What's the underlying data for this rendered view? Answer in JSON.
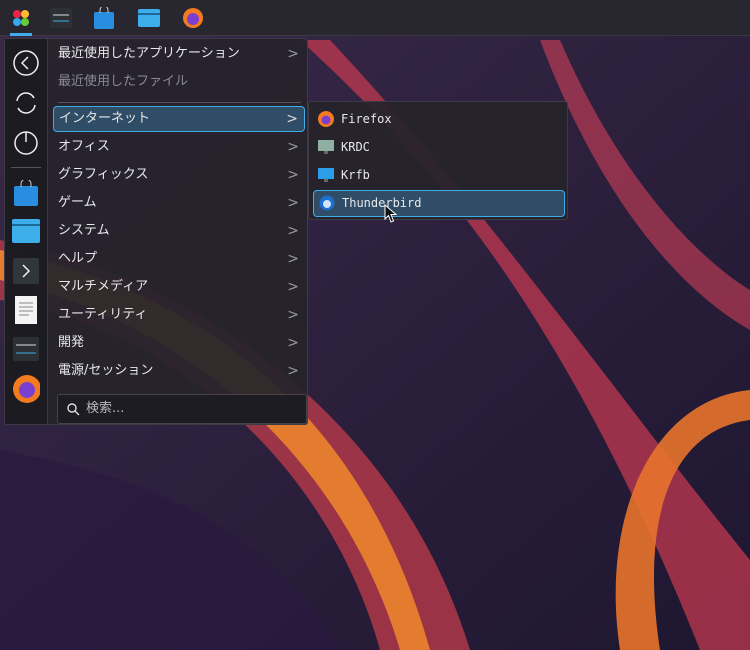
{
  "panel": {
    "icons": [
      "app-launcher-icon",
      "settings-icon",
      "discover-store-icon",
      "file-manager-icon",
      "firefox-icon"
    ]
  },
  "menu": {
    "items": [
      {
        "label": "最近使用したアプリケーション",
        "arrow": true
      },
      {
        "label": "最近使用したファイル",
        "arrow": false,
        "disabled": true
      },
      {
        "label": "インターネット",
        "arrow": true,
        "selected": true
      },
      {
        "label": "オフィス",
        "arrow": true
      },
      {
        "label": "グラフィックス",
        "arrow": true
      },
      {
        "label": "ゲーム",
        "arrow": true
      },
      {
        "label": "システム",
        "arrow": true
      },
      {
        "label": "ヘルプ",
        "arrow": true
      },
      {
        "label": "マルチメディア",
        "arrow": true
      },
      {
        "label": "ユーティリティ",
        "arrow": true
      },
      {
        "label": "開発",
        "arrow": true
      },
      {
        "label": "電源/セッション",
        "arrow": true
      }
    ],
    "chevron": ">",
    "search_placeholder": "検索..."
  },
  "submenu": {
    "items": [
      {
        "label": "Firefox"
      },
      {
        "label": "KRDC"
      },
      {
        "label": "Krfb"
      },
      {
        "label": "Thunderbird",
        "selected": true
      }
    ]
  },
  "colors": {
    "accent": "#3daee9",
    "selection": "#2f4d66"
  }
}
